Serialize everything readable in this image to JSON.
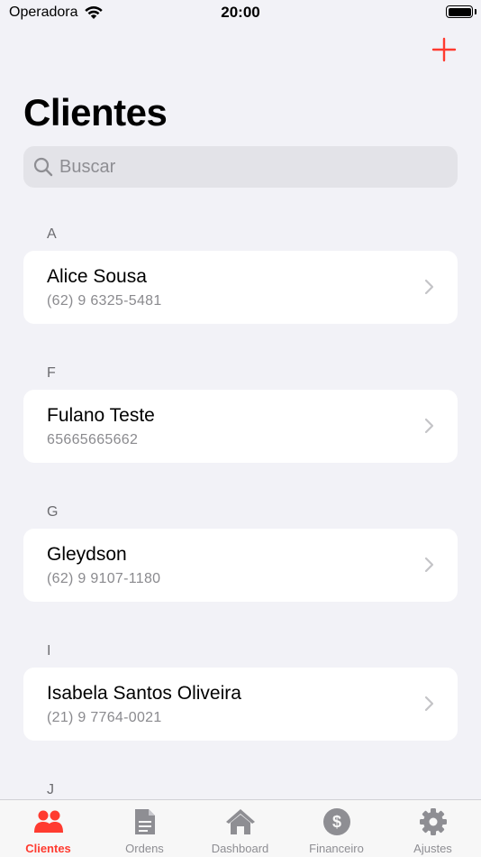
{
  "status_bar": {
    "carrier": "Operadora",
    "time": "20:00"
  },
  "header": {
    "title": "Clientes"
  },
  "search": {
    "placeholder": "Buscar"
  },
  "sections": [
    {
      "letter": "A",
      "clients": [
        {
          "name": "Alice Sousa",
          "phone": "(62) 9 6325-5481"
        }
      ]
    },
    {
      "letter": "F",
      "clients": [
        {
          "name": "Fulano Teste",
          "phone": "65665665662"
        }
      ]
    },
    {
      "letter": "G",
      "clients": [
        {
          "name": "Gleydson",
          "phone": "(62) 9 9107-1180"
        }
      ]
    },
    {
      "letter": "I",
      "clients": [
        {
          "name": "Isabela Santos Oliveira",
          "phone": "(21) 9 7764-0021"
        }
      ]
    },
    {
      "letter": "J",
      "clients": []
    }
  ],
  "tabs": [
    {
      "label": "Clientes",
      "icon": "people-icon",
      "active": true
    },
    {
      "label": "Ordens",
      "icon": "document-icon",
      "active": false
    },
    {
      "label": "Dashboard",
      "icon": "house-icon",
      "active": false
    },
    {
      "label": "Financeiro",
      "icon": "dollar-icon",
      "active": false
    },
    {
      "label": "Ajustes",
      "icon": "gear-icon",
      "active": false
    }
  ],
  "colors": {
    "accent": "#ff3b30",
    "inactive": "#8e8e93",
    "background": "#f2f2f7"
  }
}
